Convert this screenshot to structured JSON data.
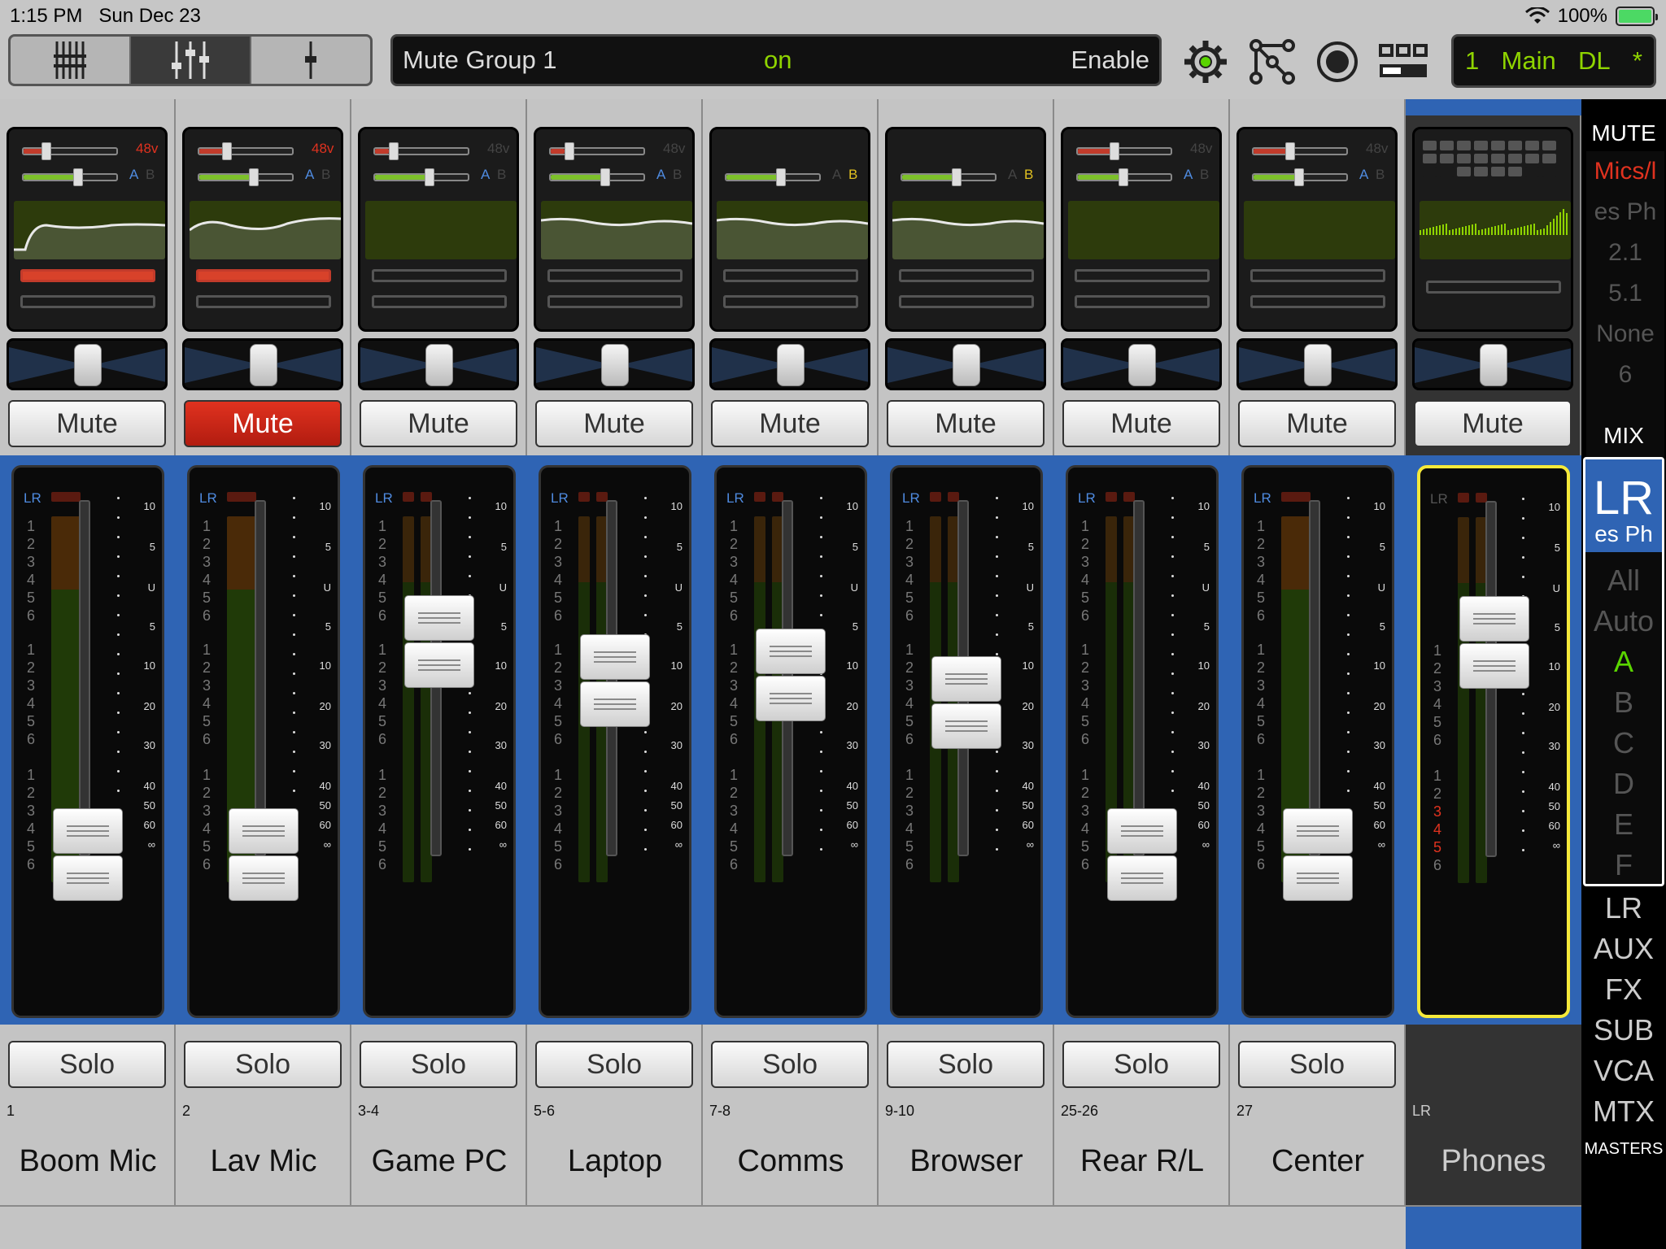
{
  "status_bar": {
    "time": "1:15 PM",
    "date": "Sun Dec 23",
    "battery": "100%"
  },
  "toolbar": {
    "view_tabs": [
      "overview-icon",
      "mixer-icon",
      "single-fader-icon"
    ],
    "active_view": 1,
    "display": {
      "left": "Mute Group 1",
      "center": "on",
      "right": "Enable"
    },
    "icons": [
      "gear-icon",
      "routing-icon",
      "record-icon",
      "layout-icon"
    ],
    "mix_selector": {
      "number": "1",
      "name": "Main",
      "mode": "DL",
      "star": "*"
    }
  },
  "channels": [
    {
      "id": "1",
      "name": "Boom Mic",
      "mute": "Mute",
      "muted": true,
      "mute_red": false,
      "solo": "Solo",
      "phantom": "48v",
      "phantom_on": true,
      "gain": 0.2,
      "trim": 0.55,
      "ab": [
        "A",
        "B"
      ],
      "ab_active": "A",
      "eq": "low-cut",
      "dyn_on": true,
      "fader": 0.05,
      "stereo": false
    },
    {
      "id": "2",
      "name": "Lav Mic",
      "mute": "Mute",
      "muted": true,
      "mute_red": true,
      "solo": "Solo",
      "phantom": "48v",
      "phantom_on": true,
      "gain": 0.25,
      "trim": 0.55,
      "ab": [
        "A",
        "B"
      ],
      "ab_active": "A",
      "eq": "mid",
      "dyn_on": true,
      "fader": 0.05,
      "stereo": false
    },
    {
      "id": "3-4",
      "name": "Game PC",
      "mute": "Mute",
      "muted": false,
      "mute_red": false,
      "solo": "Solo",
      "phantom": "48v",
      "phantom_on": false,
      "gain": 0.15,
      "trim": 0.55,
      "ab": [
        "A",
        "B"
      ],
      "ab_active": "A",
      "eq": "flat",
      "dyn_on": false,
      "fader": 0.82,
      "stereo": true
    },
    {
      "id": "5-6",
      "name": "Laptop",
      "mute": "Mute",
      "muted": false,
      "mute_red": false,
      "solo": "Solo",
      "phantom": "48v",
      "phantom_on": false,
      "gain": 0.15,
      "trim": 0.55,
      "ab": [
        "A",
        "B"
      ],
      "ab_active": "A",
      "eq": "gentle",
      "dyn_on": false,
      "fader": 0.68,
      "stereo": true
    },
    {
      "id": "7-8",
      "name": "Comms",
      "mute": "Mute",
      "muted": false,
      "mute_red": false,
      "solo": "Solo",
      "phantom": "",
      "phantom_on": false,
      "gain": null,
      "trim": 0.55,
      "ab": [
        "A",
        "B"
      ],
      "ab_active": "B",
      "eq": "gentle",
      "dyn_on": false,
      "fader": 0.7,
      "stereo": true
    },
    {
      "id": "9-10",
      "name": "Browser",
      "mute": "Mute",
      "muted": false,
      "mute_red": false,
      "solo": "Solo",
      "phantom": "",
      "phantom_on": false,
      "gain": null,
      "trim": 0.55,
      "ab": [
        "A",
        "B"
      ],
      "ab_active": "B",
      "eq": "gentle",
      "dyn_on": false,
      "fader": 0.6,
      "stereo": true
    },
    {
      "id": "25-26",
      "name": "Rear R/L",
      "mute": "Mute",
      "muted": false,
      "mute_red": false,
      "solo": "Solo",
      "phantom": "48v",
      "phantom_on": false,
      "gain": 0.35,
      "trim": 0.45,
      "ab": [
        "A",
        "B"
      ],
      "ab_active": "A",
      "eq": "flat",
      "dyn_on": false,
      "fader": 0.05,
      "stereo": true
    },
    {
      "id": "27",
      "name": "Center",
      "mute": "Mute",
      "muted": false,
      "mute_red": false,
      "solo": "Solo",
      "phantom": "48v",
      "phantom_on": false,
      "gain": 0.35,
      "trim": 0.45,
      "ab": [
        "A",
        "B"
      ],
      "ab_active": "A",
      "eq": "flat",
      "dyn_on": false,
      "fader": 0.05,
      "stereo": false
    }
  ],
  "master": {
    "id": "LR",
    "name": "Phones",
    "mute": "Mute",
    "fader": 0.82
  },
  "lr_label": "LR",
  "meter_numbers": [
    "1",
    "2",
    "3",
    "4",
    "5",
    "6"
  ],
  "scale_marks": [
    "10",
    "5",
    "U",
    "5",
    "10",
    "20",
    "30",
    "40",
    "50",
    "60",
    "∞"
  ],
  "sidebar": {
    "mute_title": "MUTE",
    "mute_groups": [
      "Mics/l",
      "es  Ph",
      "2.1",
      "5.1",
      "None",
      "6"
    ],
    "mix_title": "MIX",
    "mix_main": "LR",
    "mix_sub": "es  Ph",
    "mix_options": [
      "All",
      "Auto",
      "A",
      "B",
      "C",
      "D",
      "E",
      "F"
    ],
    "mix_active": "A",
    "masters": [
      "LR",
      "AUX",
      "FX",
      "SUB",
      "VCA",
      "MTX"
    ],
    "masters_title": "MASTERS"
  }
}
